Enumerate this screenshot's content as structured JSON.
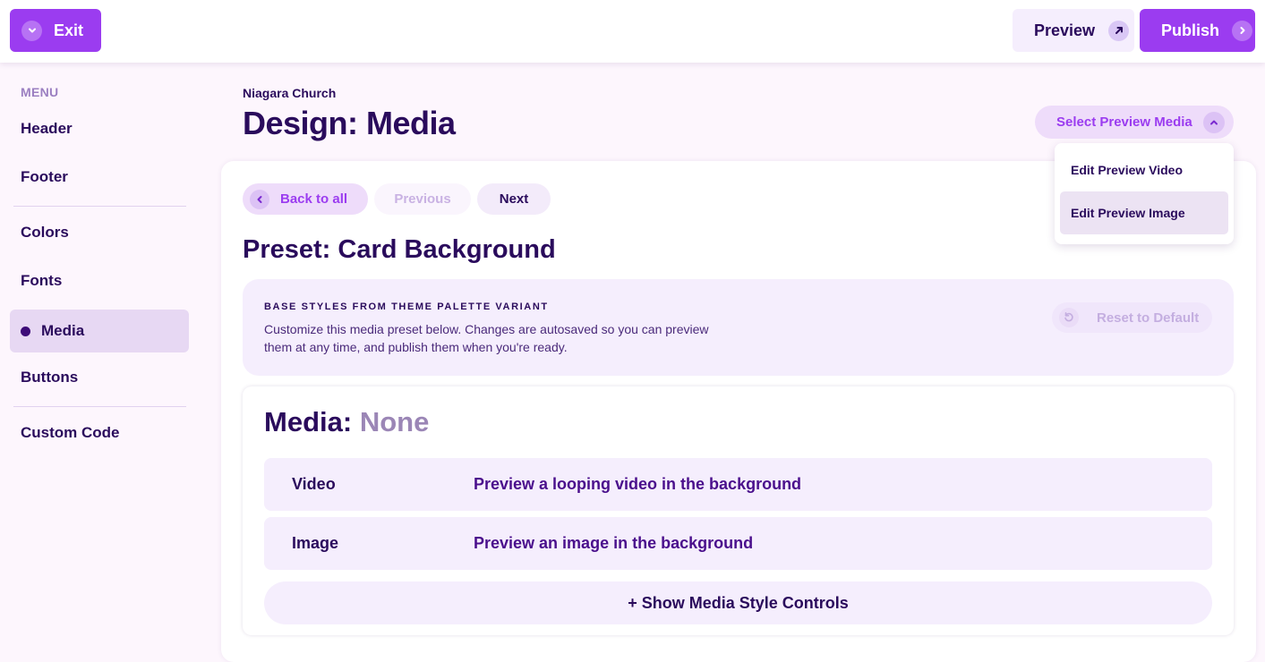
{
  "topbar": {
    "exit_label": "Exit",
    "preview_label": "Preview",
    "publish_label": "Publish"
  },
  "sidebar": {
    "menu_label": "MENU",
    "items": [
      {
        "label": "Header"
      },
      {
        "label": "Footer"
      },
      {
        "label": "Colors"
      },
      {
        "label": "Fonts"
      },
      {
        "label": "Media",
        "active": true
      },
      {
        "label": "Buttons"
      },
      {
        "label": "Custom Code"
      }
    ]
  },
  "header": {
    "org_name": "Niagara Church",
    "title": "Design: Media"
  },
  "preview_media": {
    "button_label": "Select Preview Media",
    "options": [
      {
        "label": "Edit Preview Video"
      },
      {
        "label": "Edit Preview Image"
      }
    ]
  },
  "nav": {
    "back_label": "Back to all",
    "previous_label": "Previous",
    "next_label": "Next"
  },
  "preset": {
    "title": "Preset: Card Background"
  },
  "base_styles": {
    "label": "BASE STYLES FROM THEME PALETTE VARIANT",
    "description": "Customize this media preset below. Changes are autosaved so you can preview them at any time, and publish them when you're ready.",
    "reset_label": "Reset to Default"
  },
  "media": {
    "title_prefix": "Media:",
    "title_value": "None",
    "options": [
      {
        "name": "Video",
        "description": "Preview a looping video in the background"
      },
      {
        "name": "Image",
        "description": "Preview an image in the background"
      }
    ],
    "show_controls_label": "+ Show Media Style Controls"
  },
  "colors": {
    "accent": "#9b3cf0",
    "text_primary": "#2a0b5c",
    "panel_bg": "#f5eefd",
    "page_bg": "#fdf6fd"
  }
}
